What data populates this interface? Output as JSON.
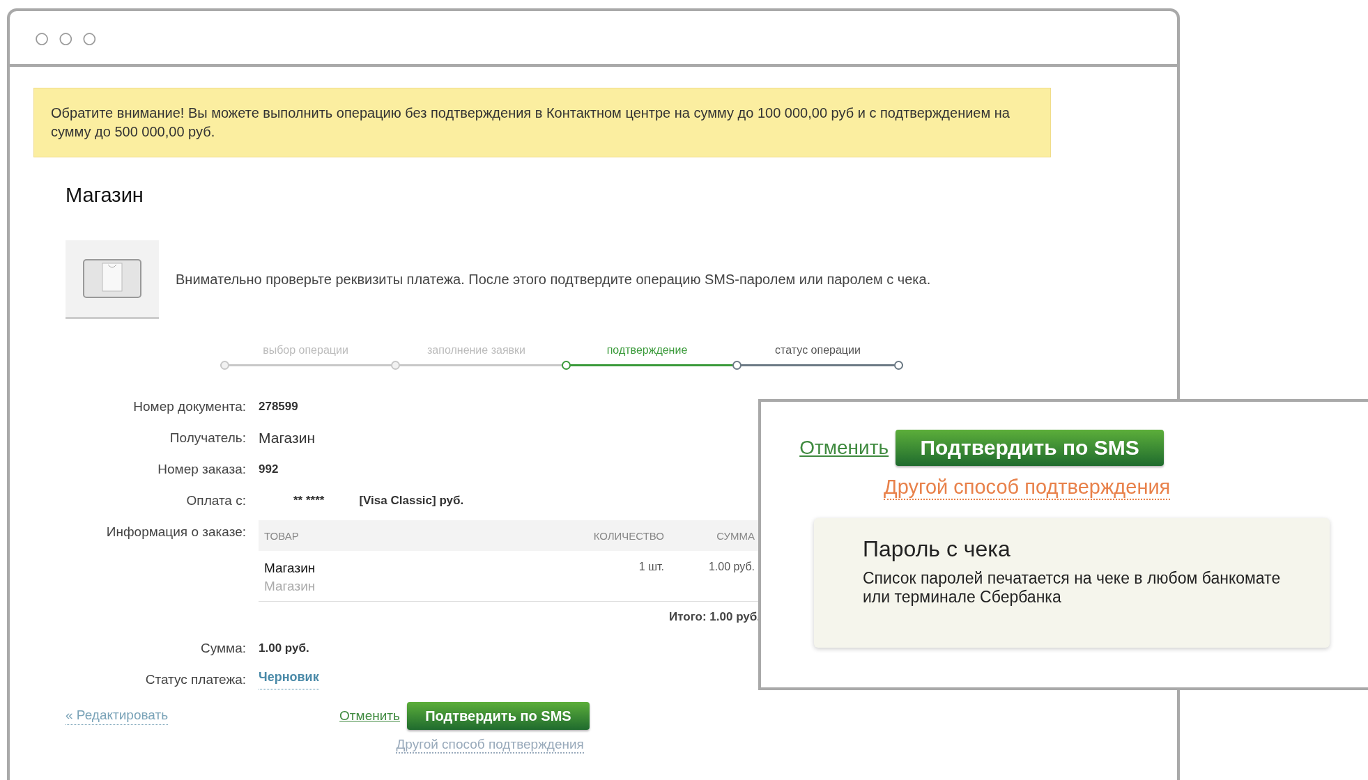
{
  "window": {
    "controls": [
      "○",
      "○",
      "○"
    ]
  },
  "notice": "Обратите внимание! Вы можете выполнить операцию без подтверждения в Контактном центре на сумму до 100 000,00 руб и с подтверждением на сумму до 500 000,00 руб.",
  "title": "Магазин",
  "instruction": "Внимательно проверьте реквизиты платежа. После этого подтвердите операцию SMS-паролем или паролем с чека.",
  "steps": [
    {
      "label": "выбор операции",
      "done": true,
      "selected": false
    },
    {
      "label": "заполнение заявки",
      "done": true,
      "selected": false
    },
    {
      "label": "подтверждение",
      "done": false,
      "selected": true
    },
    {
      "label": "статус операции",
      "done": false,
      "selected": false
    }
  ],
  "fields": [
    {
      "label": "Номер документа:",
      "value": "278599",
      "kind": "bold"
    },
    {
      "label": "Получатель:",
      "value": "Магазин",
      "kind": "plain"
    },
    {
      "label": "Номер заказа:",
      "value": "992",
      "kind": "bold"
    },
    {
      "label": "Оплата с:",
      "value": "** ****",
      "extra": "[Visa Classic]  руб.",
      "kind": "card"
    }
  ],
  "order": {
    "label": "Информация о заказе:",
    "columns": [
      "ТОВАР",
      "КОЛИЧЕСТВО",
      "СУММА"
    ],
    "rows": [
      {
        "name": "Магазин",
        "description": "Магазин",
        "quantity": "1 шт.",
        "sum": "1.00  руб."
      }
    ],
    "total": "Итого: 1.00 руб."
  },
  "summary": [
    {
      "label": "Сумма:",
      "value": "1.00  руб.",
      "kind": "bold"
    },
    {
      "label": "Статус платежа:",
      "value": "Черновик",
      "kind": "status"
    }
  ],
  "actions": {
    "edit": "« Редактировать",
    "cancel": "Отменить",
    "confirm": "Подтвердить по SMS",
    "other": "Другой способ подтверждения"
  },
  "zoom_inset": {
    "cancel": "Отменить",
    "confirm": "Подтвердить по SMS",
    "other": "Другой способ подтверждения",
    "tooltip": {
      "title": "Пароль с чека",
      "text": "Список паролей печатается на чеке в любом банкомате или терминале Сбербанка"
    }
  }
}
